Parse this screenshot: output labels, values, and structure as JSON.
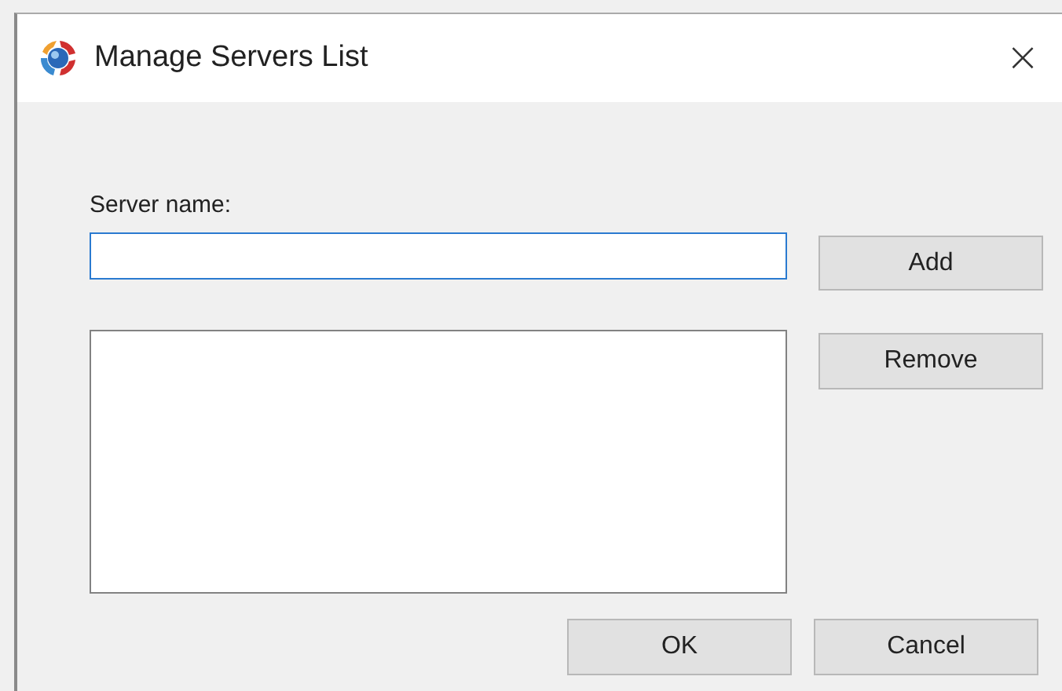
{
  "window": {
    "title": "Manage Servers List"
  },
  "server_name": {
    "label": "Server name:"
  },
  "buttons": {
    "add": "Add",
    "remove": "Remove",
    "ok": "OK",
    "cancel": "Cancel",
    "close": "×"
  }
}
